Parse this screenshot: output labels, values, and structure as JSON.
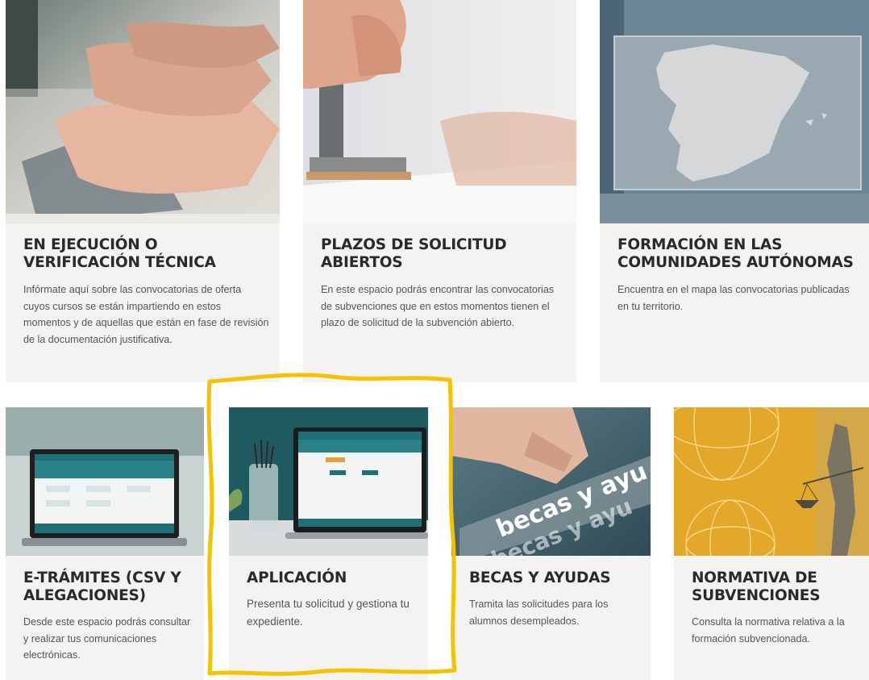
{
  "cards": [
    {
      "title": "EN EJECUCIÓN O VERIFICACIÓN TÉCNICA",
      "description": "Infórmate aquí sobre las convocatorias de oferta cuyos cursos se están impartiendo en estos momentos y de aquellas que están en fase de revisión de la documentación justificativa.",
      "image": "hands-typing-keyboard"
    },
    {
      "title": "PLAZOS DE SOLICITUD ABIERTOS",
      "description": "En este espacio podrás encontrar las convocatorias de subvenciones que en estos momentos tienen el plazo de solicitud de la subvención abierto.",
      "image": "rubber-stamp"
    },
    {
      "title": "FORMACIÓN EN LAS COMUNIDADES AUTÓNOMAS",
      "description": "Encuentra en el mapa las convocatorias publicadas en tu territorio.",
      "image": "spain-map"
    },
    {
      "title": "E-TRÁMITES (CSV Y ALEGACIONES)",
      "description": "Desde este espacio podrás consultar y realizar tus comunicaciones electrónicas.",
      "image": "laptop-website"
    },
    {
      "title": "APLICACIÓN",
      "description": "Presenta tu solicitud y gestiona tu expediente.",
      "image": "laptop-desk-pencils"
    },
    {
      "title": "BECAS Y AYUDAS",
      "description": "Tramita las solicitudes para los alumnos desempleados.",
      "image": "tablet-becas-y-ayudas",
      "image_text": "becas y ayudas"
    },
    {
      "title": "NORMATIVA DE SUBVENCIONES",
      "description": "Consulta la normativa relativa a la formación subvencionada.",
      "image": "justice-scales-globe"
    }
  ],
  "colors": {
    "card_bg": "#f4f3f1",
    "title": "#2a2a2a",
    "text": "#555555",
    "highlight": "#f5c200",
    "teal": "#1e6f76"
  }
}
